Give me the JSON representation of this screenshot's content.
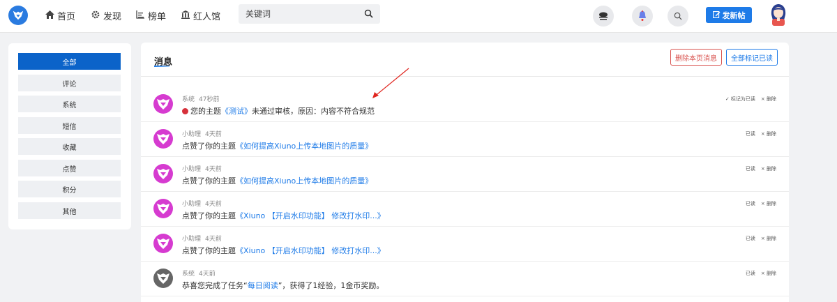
{
  "nav": {
    "items": [
      {
        "icon": "home-icon",
        "label": "首页"
      },
      {
        "icon": "gear-icon",
        "label": "发现"
      },
      {
        "icon": "chart-icon",
        "label": "榜单"
      },
      {
        "icon": "building-icon",
        "label": "红人馆"
      }
    ],
    "search_placeholder": "关键词",
    "post_label": "发新帖"
  },
  "sidebar": {
    "items": [
      {
        "label": "全部",
        "active": true
      },
      {
        "label": "评论"
      },
      {
        "label": "系统"
      },
      {
        "label": "短信"
      },
      {
        "label": "收藏"
      },
      {
        "label": "点赞"
      },
      {
        "label": "积分"
      },
      {
        "label": "其他"
      }
    ]
  },
  "main": {
    "title": "消息",
    "delete_page_label": "删除本页消息",
    "mark_all_label": "全部标记已读"
  },
  "messages": [
    {
      "sender": "系统",
      "time": "47秒前",
      "prefix": "您的主题",
      "link": "《测试》",
      "suffix": "未通过审核，原因：内容不符合规范",
      "unread": true,
      "read_label": "✓ 标记为已读",
      "delete_label": "× 删除"
    },
    {
      "sender": "小助理",
      "time": "4天前",
      "prefix": "点赞了你的主题",
      "link": "《如何提高Xiuno上传本地图片的质量》",
      "suffix": "",
      "read_label": "已读",
      "delete_label": "× 删除"
    },
    {
      "sender": "小助理",
      "time": "4天前",
      "prefix": "点赞了你的主题",
      "link": "《如何提高Xiuno上传本地图片的质量》",
      "suffix": "",
      "read_label": "已读",
      "delete_label": "× 删除"
    },
    {
      "sender": "小助理",
      "time": "4天前",
      "prefix": "点赞了你的主题",
      "link": "《Xiuno 【开启水印功能】 修改打水印...》",
      "suffix": "",
      "read_label": "已读",
      "delete_label": "× 删除"
    },
    {
      "sender": "小助理",
      "time": "4天前",
      "prefix": "点赞了你的主题",
      "link": "《Xiuno 【开启水印功能】 修改打水印...》",
      "suffix": "",
      "read_label": "已读",
      "delete_label": "× 删除"
    },
    {
      "sender": "系统",
      "time": "4天前",
      "prefix": "恭喜您完成了任务“",
      "link": "每日阅读",
      "suffix": "”，获得了1经验，1金币奖励。",
      "read_label": "已读",
      "delete_label": "× 删除"
    }
  ],
  "colors": {
    "accent": "#1e7be8",
    "danger": "#d9534f",
    "avatar_pink": "#d63bd0",
    "avatar_gray": "#666666"
  }
}
